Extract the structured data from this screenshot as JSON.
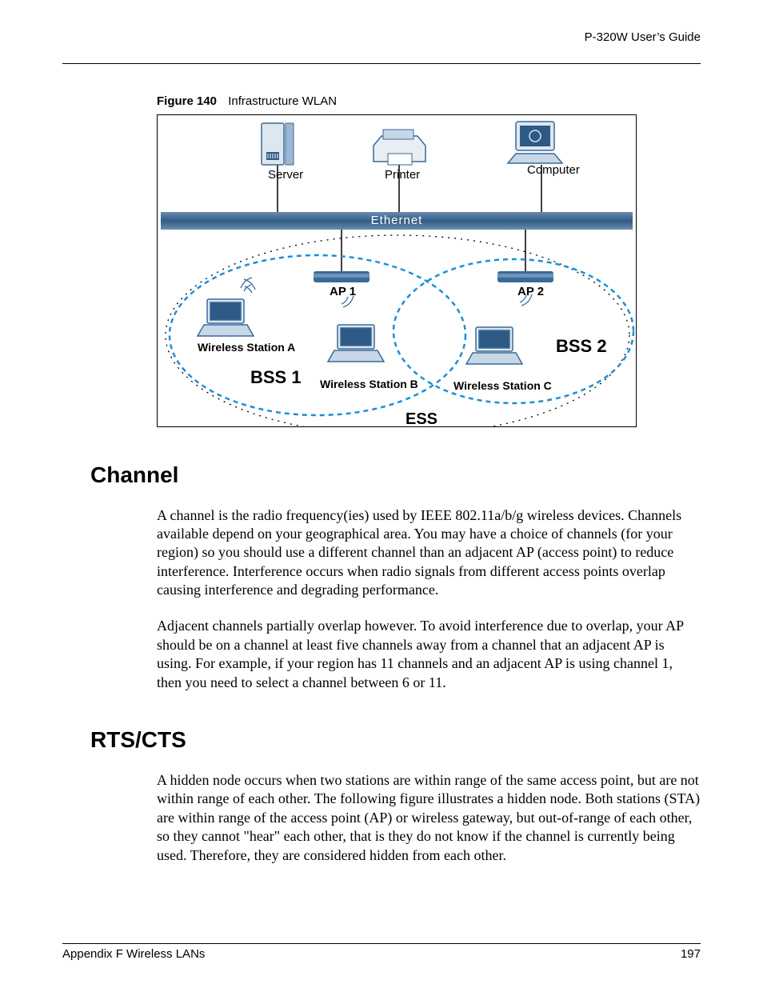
{
  "header": {
    "title": "P-320W User’s Guide"
  },
  "figure": {
    "caption_bold": "Figure 140",
    "caption_text": "Infrastructure WLAN",
    "labels": {
      "server": "Server",
      "printer": "Printer",
      "computer": "Computer",
      "ethernet": "Ethernet",
      "ap1": "AP 1",
      "ap2": "AP 2",
      "wsa": "Wireless Station A",
      "wsb": "Wireless Station B",
      "wsc": "Wireless Station C",
      "bss1": "BSS 1",
      "bss2": "BSS 2",
      "ess": "ESS"
    }
  },
  "sections": {
    "channel": {
      "heading": "Channel",
      "p1": "A channel is the radio frequency(ies) used by IEEE 802.11a/b/g wireless devices. Channels available depend on your geographical area. You may have a choice of channels (for your region) so you should use a different channel than an adjacent AP (access point) to reduce interference. Interference occurs when radio signals from different access points overlap causing interference and degrading performance.",
      "p2": "Adjacent channels partially overlap however. To avoid interference due to overlap, your AP should be on a channel at least five channels away from a channel that an adjacent AP is using. For example, if your region has 11 channels and an adjacent AP is using channel 1, then you need to select a channel between 6 or 11."
    },
    "rtscts": {
      "heading": "RTS/CTS",
      "p1": "A hidden node occurs when two stations are within range of the same access point, but are not within range of each other. The following figure illustrates a hidden node. Both stations (STA) are within range of the access point (AP) or wireless gateway, but out-of-range of each other, so they cannot \"hear\" each other, that is they do not know if the channel is currently being used. Therefore, they are considered hidden from each other."
    }
  },
  "footer": {
    "left": "Appendix F Wireless LANs",
    "right": "197"
  }
}
